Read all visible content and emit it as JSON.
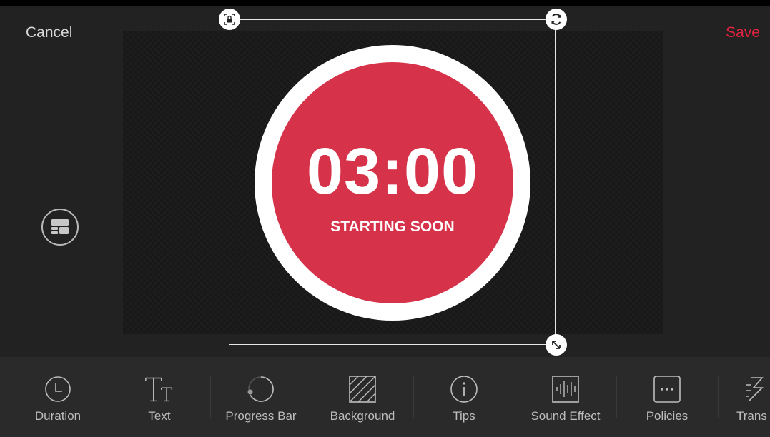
{
  "header": {
    "cancel_label": "Cancel",
    "save_label": "Save"
  },
  "canvas": {
    "timer_time": "03:00",
    "timer_subtitle": "STARTING SOON"
  },
  "colors": {
    "accent": "#e0243f",
    "timer_fill": "#d6324a",
    "timer_ring": "#ffffff",
    "background": "#222222",
    "toolbar_background": "#2a2a2a"
  },
  "icons": {
    "layout": "layout-icon",
    "lock_handle": "lock-icon",
    "rotate_handle": "rotate-icon",
    "resize_handle": "resize-icon"
  },
  "toolbar": {
    "items": [
      {
        "label": "Duration",
        "icon": "clock-icon"
      },
      {
        "label": "Text",
        "icon": "text-icon"
      },
      {
        "label": "Progress Bar",
        "icon": "progress-ring-icon"
      },
      {
        "label": "Background",
        "icon": "background-hatch-icon"
      },
      {
        "label": "Tips",
        "icon": "info-icon"
      },
      {
        "label": "Sound Effect",
        "icon": "waveform-icon"
      },
      {
        "label": "Policies",
        "icon": "more-dots-icon"
      },
      {
        "label": "Trans",
        "icon": "transition-icon"
      }
    ]
  }
}
